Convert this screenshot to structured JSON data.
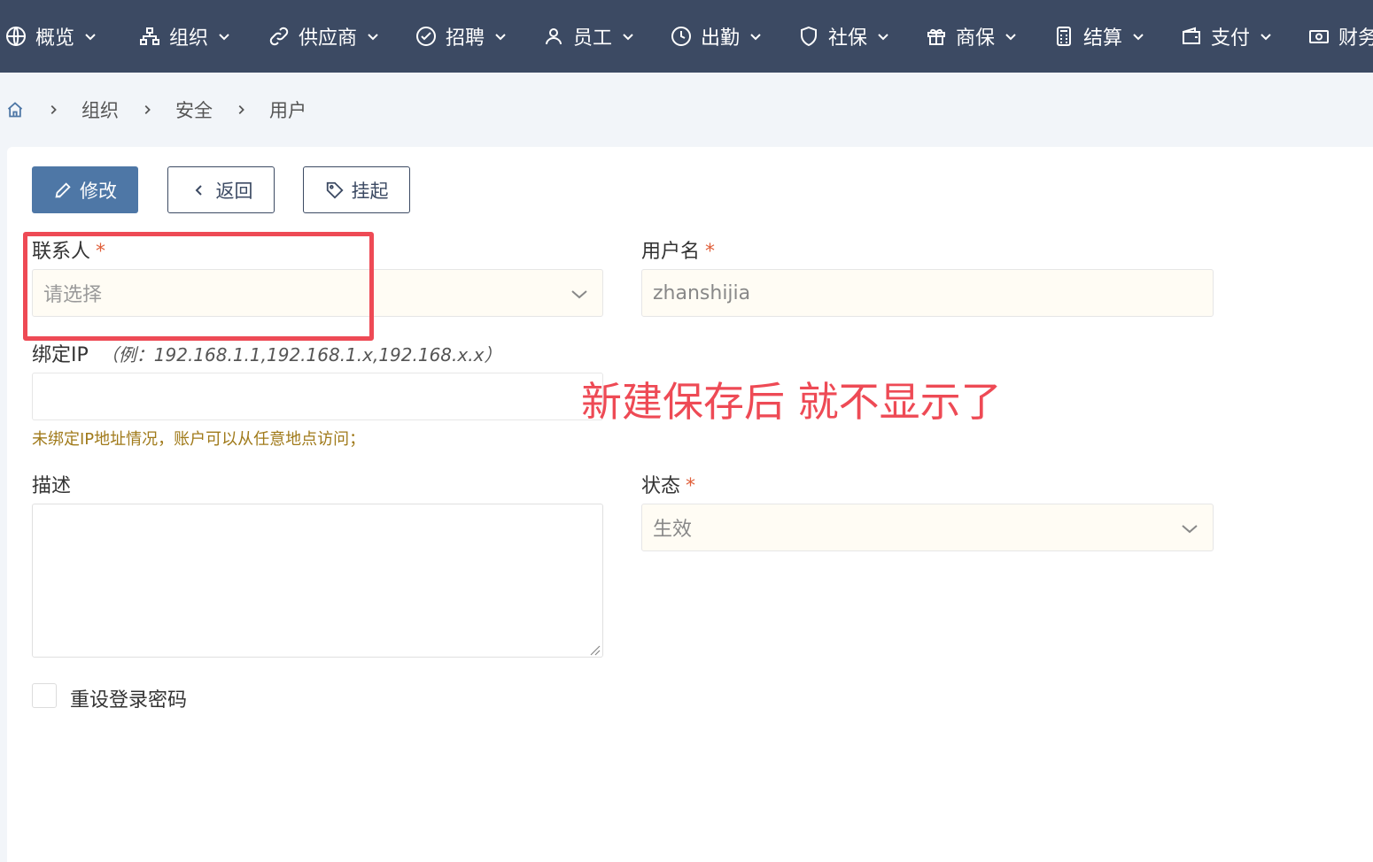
{
  "nav": {
    "items": [
      {
        "label": "概览",
        "icon": "globe-icon"
      },
      {
        "label": "组织",
        "icon": "org-chart-icon"
      },
      {
        "label": "供应商",
        "icon": "link-icon"
      },
      {
        "label": "招聘",
        "icon": "check-badge-icon"
      },
      {
        "label": "员工",
        "icon": "user-icon"
      },
      {
        "label": "出勤",
        "icon": "clock-icon"
      },
      {
        "label": "社保",
        "icon": "shield-icon"
      },
      {
        "label": "商保",
        "icon": "gift-icon"
      },
      {
        "label": "结算",
        "icon": "calculator-icon"
      },
      {
        "label": "支付",
        "icon": "wallet-icon"
      },
      {
        "label": "财务",
        "icon": "cash-icon"
      }
    ]
  },
  "breadcrumb": {
    "items": [
      "组织",
      "安全",
      "用户"
    ]
  },
  "toolbar": {
    "edit_label": "修改",
    "back_label": "返回",
    "hang_label": "挂起"
  },
  "form": {
    "contact": {
      "label": "联系人",
      "required": "*",
      "placeholder": "请选择"
    },
    "username": {
      "label": "用户名",
      "required": "*",
      "value": "zhanshijia"
    },
    "bind_ip": {
      "label": "绑定IP",
      "hint": "（例：192.168.1.1,192.168.1.x,192.168.x.x）",
      "value": "",
      "helper": "未绑定IP地址情况，账户可以从任意地点访问；"
    },
    "description": {
      "label": "描述",
      "value": ""
    },
    "status": {
      "label": "状态",
      "required": "*",
      "value": "生效"
    },
    "reset_password": {
      "label": "重设登录密码"
    }
  },
  "annotation": {
    "text": "新建保存后 就不显示了",
    "color": "#ee4a55"
  },
  "colors": {
    "nav_bg": "#3c4a63",
    "primary": "#4e77a6",
    "required": "#e0603b",
    "helper": "#a07a1a"
  }
}
